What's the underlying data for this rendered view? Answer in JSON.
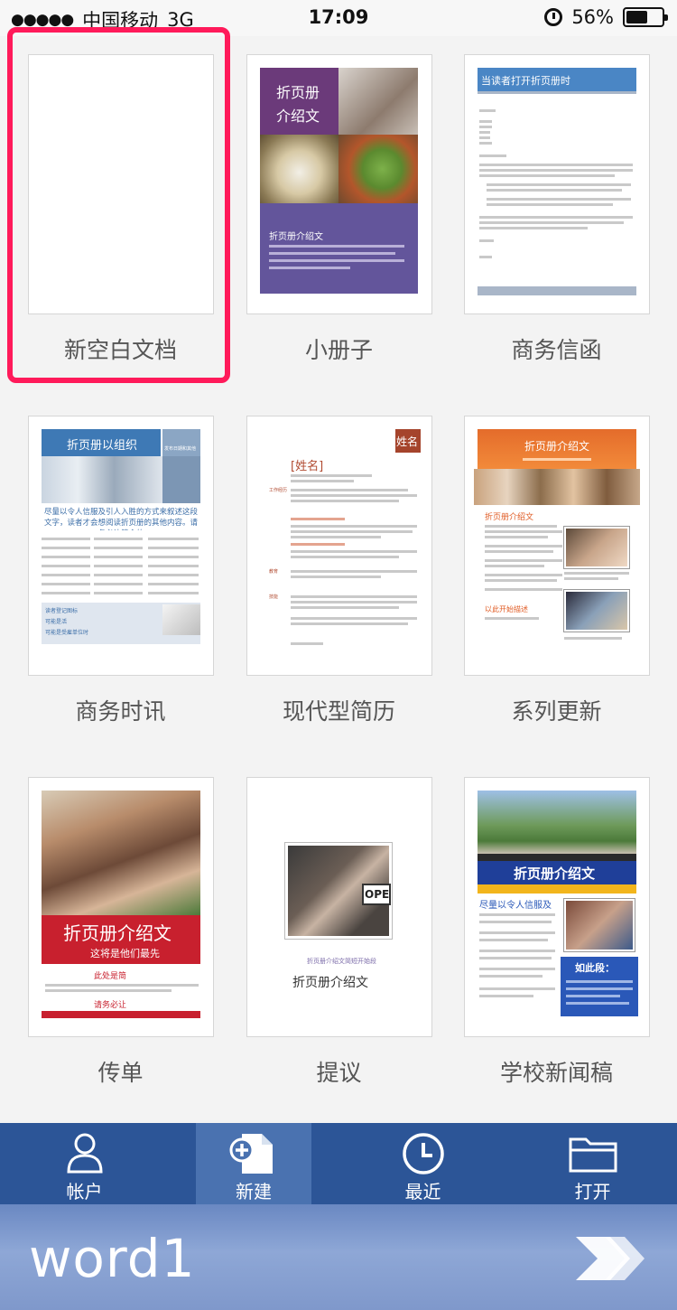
{
  "status": {
    "carrier": "中国移动",
    "network": "3G",
    "time": "17:09",
    "battery": "56%"
  },
  "templates": [
    {
      "label": "新空白文档",
      "selected": true
    },
    {
      "label": "小册子",
      "cover_title_1": "折页册",
      "cover_title_2": "介绍文",
      "subtitle": "折页册介绍文"
    },
    {
      "label": "商务信函",
      "heading": "当读者打开折页册时"
    },
    {
      "label": "商务时讯",
      "heading": "折页册以组织",
      "side": "发布日期和其他",
      "lead": "尽量以令人信服及引人入胜的方式来叙述这段文字，读者才会想阅读折页册的其他内容。请务必让简介的",
      "foot1": "读者登记图标",
      "foot2": "可能是活",
      "foot3": "可能是受雇单位时"
    },
    {
      "label": "现代型简历",
      "name_tag": "姓名",
      "name_field": "[姓名]",
      "sec1": "工作经历",
      "sec2": "教育",
      "sec3": "技能"
    },
    {
      "label": "系列更新",
      "heading": "折页册介绍文",
      "sub": "折页册介绍文",
      "h1": "折页册介绍文",
      "h2": "以此开始描述"
    },
    {
      "label": "传单",
      "title": "折页册介绍文",
      "sub": "这将是他们最先",
      "h1": "此处是简",
      "h2": "请务必让"
    },
    {
      "label": "提议",
      "caption": "折页册介绍文简短开始段",
      "title": "折页册介绍文",
      "sign": "OPE"
    },
    {
      "label": "学校新闻稿",
      "banner": "折页册介绍文",
      "h1": "尽量以令人信服及",
      "h2": "如此段："
    }
  ],
  "tabs": [
    {
      "label": "帐户",
      "icon": "person-icon"
    },
    {
      "label": "新建",
      "icon": "new-document-icon"
    },
    {
      "label": "最近",
      "icon": "clock-icon"
    },
    {
      "label": "打开",
      "icon": "folder-icon"
    }
  ],
  "app": {
    "name": "word1"
  },
  "colors": {
    "accent": "#2c5597",
    "selection": "#ff1a5a"
  }
}
